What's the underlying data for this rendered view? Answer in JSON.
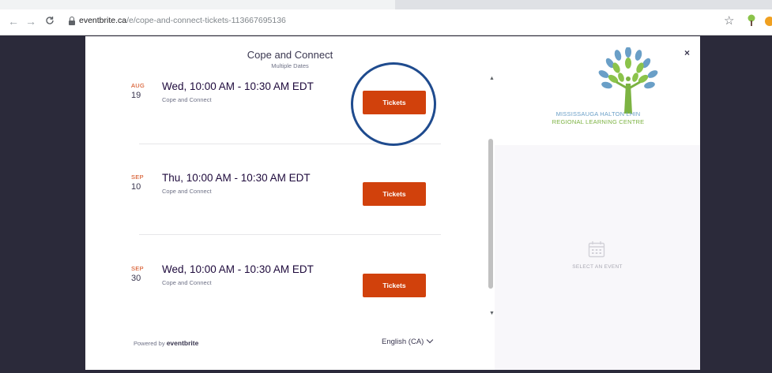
{
  "browser": {
    "back_icon": "arrow-left-icon",
    "forward_icon": "arrow-right-icon",
    "reload_icon": "reload-icon",
    "url_host": "eventbrite.ca",
    "url_path": "/e/cope-and-connect-tickets-113667695136"
  },
  "modal": {
    "title": "Cope and Connect",
    "subtitle": "Multiple Dates",
    "events": [
      {
        "month": "AUG",
        "day": "19",
        "when": "Wed, 10:00 AM - 10:30 AM EDT",
        "org": "Cope and Connect",
        "button": "Tickets"
      },
      {
        "month": "SEP",
        "day": "10",
        "when": "Thu, 10:00 AM - 10:30 AM EDT",
        "org": "Cope and Connect",
        "button": "Tickets"
      },
      {
        "month": "SEP",
        "day": "30",
        "when": "Wed, 10:00 AM - 10:30 AM EDT",
        "org": "Cope and Connect",
        "button": "Tickets"
      }
    ],
    "footer": {
      "powered_by": "Powered by",
      "brand": "eventbrite",
      "language": "English (CA)"
    },
    "side": {
      "close": "×",
      "logo_line1": "MISSISSAUGA HALTON LHIN",
      "logo_line2": "REGIONAL LEARNING CENTRE",
      "select_prompt": "SELECT AN EVENT"
    }
  },
  "colors": {
    "accent": "#d1410c",
    "highlight_circle": "#1f4b8e",
    "overlay": "#2b2a3a"
  }
}
